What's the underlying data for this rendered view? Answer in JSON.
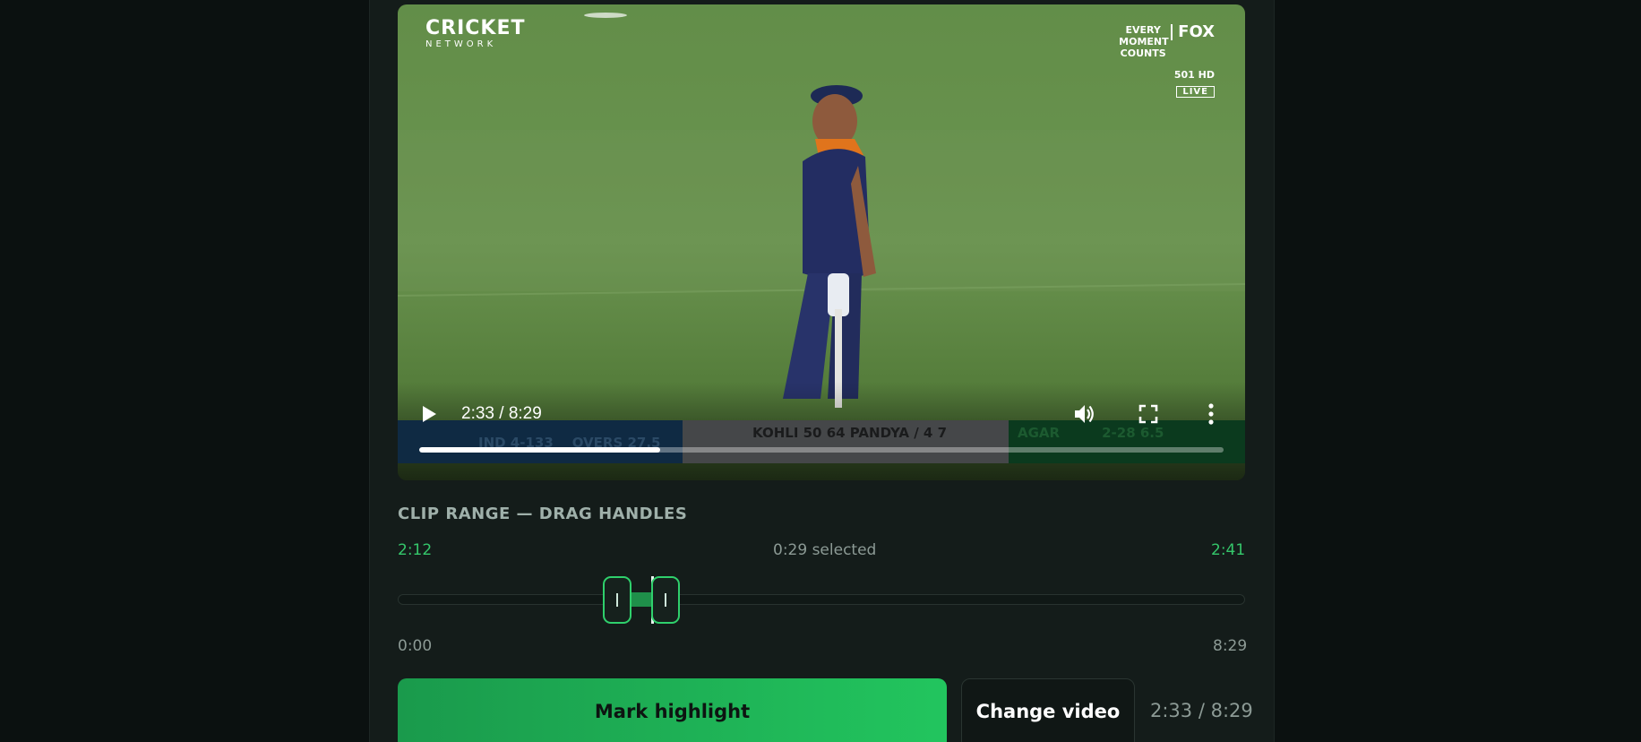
{
  "video": {
    "brand_left_line1": "CRICKET",
    "brand_left_line2": "NETWORK",
    "brand_right_tagline": "EVERY MOMENT COUNTS",
    "brand_right_logo": "FOX",
    "brand_right_channel": "501 HD",
    "brand_right_live": "LIVE",
    "scorebar": {
      "team_score": "IND 4-133",
      "overs": "OVERS 27.5",
      "batters": "KOHLI 50 64    PANDYA / 4 7",
      "bowler": "AGAR",
      "bowler_figures": "2-28 6.5"
    },
    "time_display": "2:33 / 8:29",
    "progress": 0.3
  },
  "clip_range": {
    "title": "CLIP RANGE — DRAG HANDLES",
    "start": "2:12",
    "selected": "0:29 selected",
    "end": "2:41",
    "min": "0:00",
    "max": "8:29",
    "start_fraction": 0.259,
    "end_fraction": 0.316,
    "playhead_fraction": 0.3
  },
  "actions": {
    "mark_label": "Mark highlight",
    "change_label": "Change video",
    "time": "2:33 / 8:29"
  },
  "colors": {
    "accent": "#22c55e",
    "background": "#0b1110",
    "panel": "#141c1a"
  },
  "icons": [
    "play-icon",
    "volume-icon",
    "fullscreen-icon",
    "more-vert-icon"
  ]
}
